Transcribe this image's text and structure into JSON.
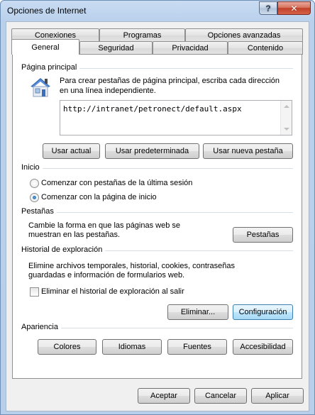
{
  "window": {
    "title": "Opciones de Internet",
    "help_label": "?",
    "close_label": "✕"
  },
  "tabs_row1": [
    "Conexiones",
    "Programas",
    "Opciones avanzadas"
  ],
  "tabs_row2": [
    "General",
    "Seguridad",
    "Privacidad",
    "Contenido"
  ],
  "active_tab": "General",
  "homepage": {
    "title": "Página principal",
    "description_line1": "Para crear pestañas de página principal, escriba cada dirección",
    "description_line2": "en una línea independiente.",
    "url": "http://intranet/petronect/default.aspx",
    "use_current": "Usar actual",
    "use_default": "Usar predeterminada",
    "use_new_tab": "Usar nueva pestaña"
  },
  "startup": {
    "title": "Inicio",
    "option_last_session": "Comenzar con pestañas de la última sesión",
    "option_homepage": "Comenzar con la página de inicio",
    "selected": "option_homepage"
  },
  "tabs_section": {
    "title": "Pestañas",
    "description_line1": "Cambie la forma en que las páginas web se",
    "description_line2": "muestran en las pestañas.",
    "button": "Pestañas"
  },
  "history": {
    "title": "Historial de exploración",
    "description_line1": "Elimine archivos temporales, historial, cookies, contraseñas",
    "description_line2": "guardadas e información de formularios web.",
    "checkbox_label": "Eliminar el historial de exploración al salir",
    "checkbox_checked": false,
    "delete_button": "Eliminar...",
    "settings_button": "Configuración"
  },
  "appearance": {
    "title": "Apariencia",
    "colors": "Colores",
    "languages": "Idiomas",
    "fonts": "Fuentes",
    "accessibility": "Accesibilidad"
  },
  "footer": {
    "accept": "Aceptar",
    "cancel": "Cancelar",
    "apply": "Aplicar"
  }
}
